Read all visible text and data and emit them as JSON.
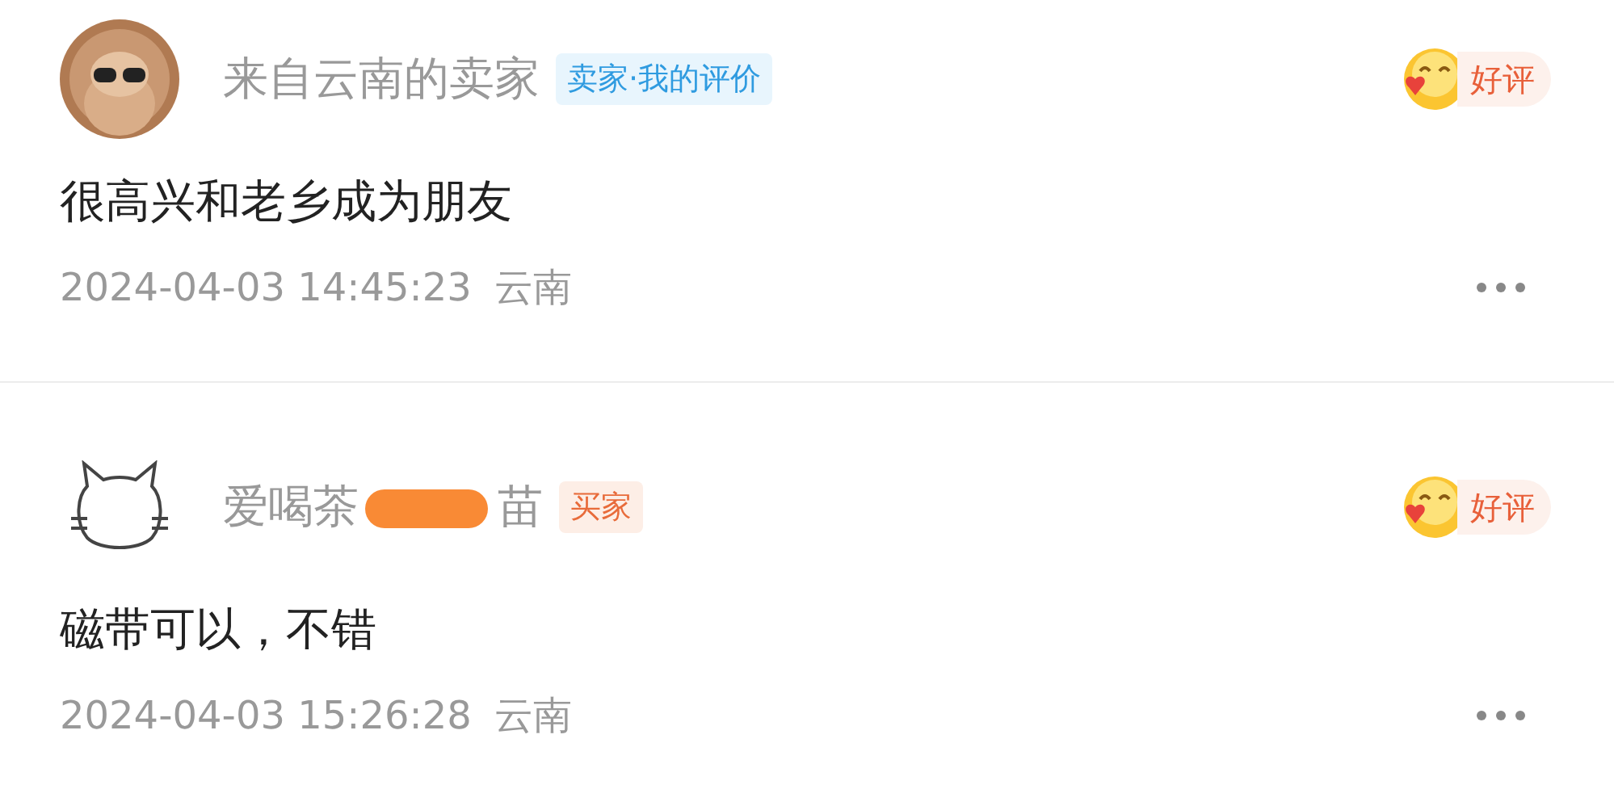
{
  "reviews": [
    {
      "name_parts": [
        "来自云南的卖家"
      ],
      "redacted": false,
      "tag": {
        "label": "卖家·我的评价",
        "kind": "seller"
      },
      "rating": "好评",
      "comment": "很高兴和老乡成为朋友",
      "time": "2024-04-03 14:45:23",
      "location": "云南"
    },
    {
      "name_parts": [
        "爱喝茶",
        "苗"
      ],
      "redacted": true,
      "tag": {
        "label": "买家",
        "kind": "buyer"
      },
      "rating": "好评",
      "comment": "磁带可以，不错",
      "time": "2024-04-03 15:26:28",
      "location": "云南"
    }
  ]
}
